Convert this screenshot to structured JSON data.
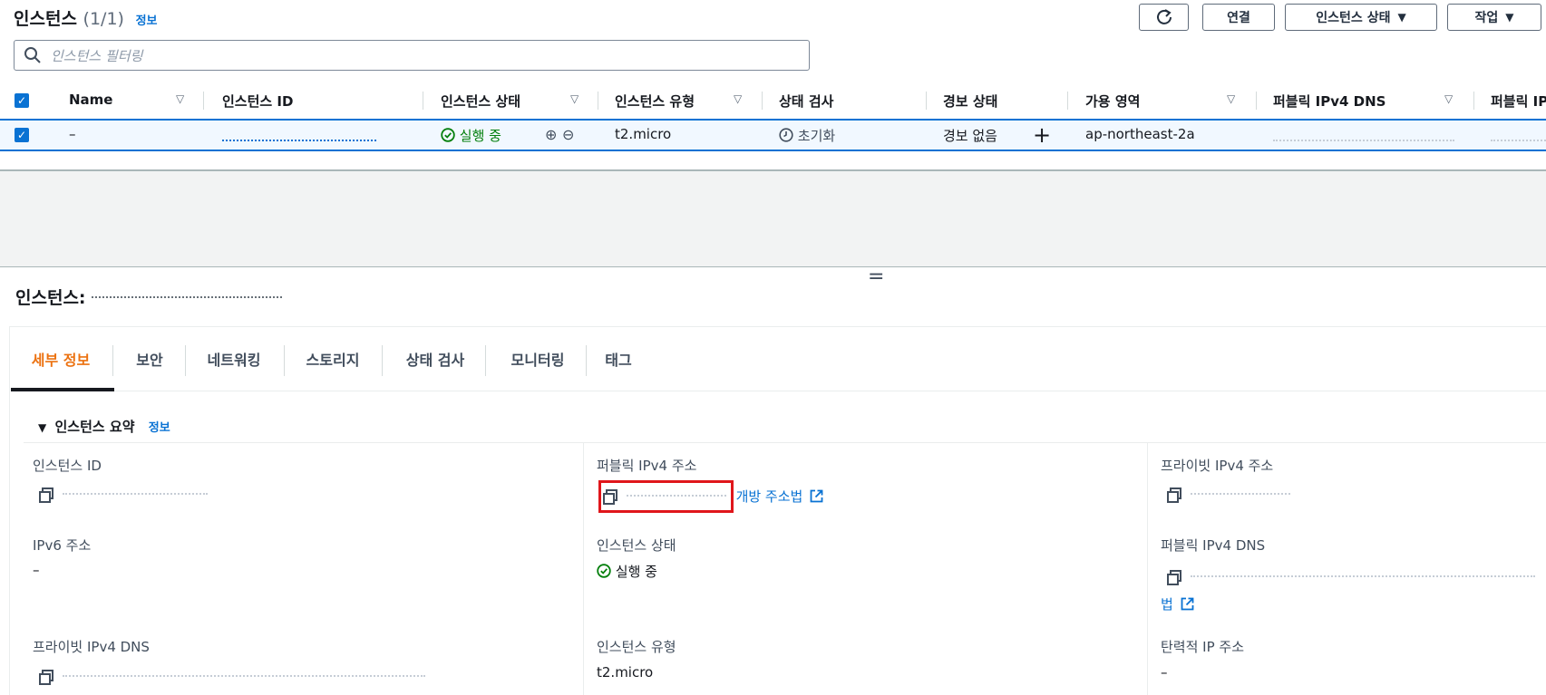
{
  "header": {
    "title": "인스턴스",
    "count": "(1/1)",
    "info": "정보",
    "refresh_icon": "refresh-icon",
    "connect": "연결",
    "instance_state": "인스턴스 상태",
    "actions": "작업"
  },
  "search": {
    "placeholder": "인스턴스 필터링"
  },
  "table": {
    "columns": [
      "Name",
      "인스턴스 ID",
      "인스턴스 상태",
      "인스턴스 유형",
      "상태 검사",
      "경보 상태",
      "가용 영역",
      "퍼블릭 IPv4 DNS",
      "퍼블릭 IP"
    ],
    "rows": [
      {
        "name": "–",
        "instance_state": "실행 중",
        "instance_type": "t2.micro",
        "status_check": "초기화",
        "alarm_status": "경보 없음",
        "availability_zone": "ap-northeast-2a"
      }
    ]
  },
  "splitter": {
    "handle": "="
  },
  "detail": {
    "title": "인스턴스:",
    "tabs": [
      "세부 정보",
      "보안",
      "네트워킹",
      "스토리지",
      "상태 검사",
      "모니터링",
      "태그"
    ],
    "active_tab": "세부 정보",
    "summary": {
      "title": "인스턴스 요약",
      "info": "정보"
    },
    "fields": {
      "instance_id_label": "인스턴스 ID",
      "public_ipv4_label": "퍼블릭 IPv4 주소",
      "open_address": "개방 주소법",
      "private_ipv4_label": "프라이빗 IPv4 주소",
      "ipv6_label": "IPv6 주소",
      "ipv6_value": "–",
      "instance_state_label": "인스턴스 상태",
      "instance_state_value": "실행 중",
      "public_dns_label": "퍼블릭 IPv4 DNS",
      "public_dns_link_tail": "법",
      "private_dns_label": "프라이빗 IPv4 DNS",
      "instance_type_label": "인스턴스 유형",
      "instance_type_value": "t2.micro",
      "elastic_ip_label": "탄력적 IP 주소",
      "elastic_ip_value": "–"
    }
  },
  "colors": {
    "accent": "#0972d3",
    "active_tab": "#ec7211",
    "running": "#037f0c",
    "highlight_box": "#e0161b"
  }
}
